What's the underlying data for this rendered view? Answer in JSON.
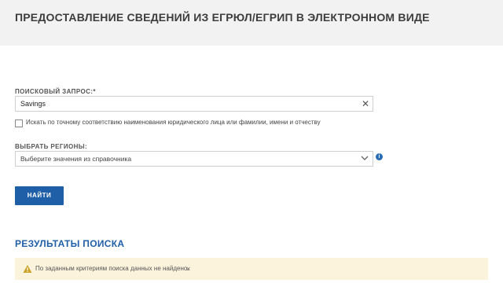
{
  "header": {
    "title": "ПРЕДОСТАВЛЕНИЕ СВЕДЕНИЙ ИЗ ЕГРЮЛ/ЕГРИП В ЭЛЕКТРОННОМ ВИДЕ"
  },
  "search_form": {
    "query_label": "ПОИСКОВЫЙ ЗАПРОС:*",
    "query_value": "Savings",
    "exact_match_label": "Искать по точному соответствию наименования юридического лица или фамилии, имени и отчеству",
    "exact_match_checked": false,
    "region_label": "ВЫБРАТЬ РЕГИОНЫ:",
    "region_placeholder": "Выберите значения из справочника",
    "submit_label": "НАЙТИ"
  },
  "results": {
    "title": "РЕЗУЛЬТАТЫ ПОИСКА",
    "message": "По заданным критериям поиска данных не найдено.",
    "close_symbol": "×"
  },
  "icons": {
    "clear": "close-icon",
    "select": "chevron-down-icon",
    "info": "info-icon",
    "warning": "warning-icon"
  },
  "colors": {
    "accent": "#1f5fa8",
    "alert_background": "#fcf3dd",
    "header_background": "#f2f2f2"
  }
}
